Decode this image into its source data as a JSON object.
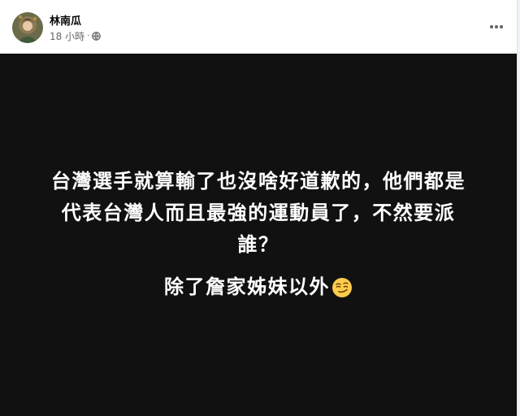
{
  "post": {
    "author": "林南瓜",
    "time": "18 小時",
    "separator": "·",
    "audience_icon": "globe-icon",
    "menu_icon": "more-icon"
  },
  "content": {
    "background": "#111111",
    "text_color": "#ffffff",
    "paragraph1_lines": [
      "台灣選手就算輸了也沒啥好道歉的，他們都是",
      "代表台灣人而且最強的運動員了，不然要派",
      "誰？"
    ],
    "paragraph2": "除了詹家姊妹以外",
    "paragraph2_emoji": "smirking-face-emoji"
  }
}
